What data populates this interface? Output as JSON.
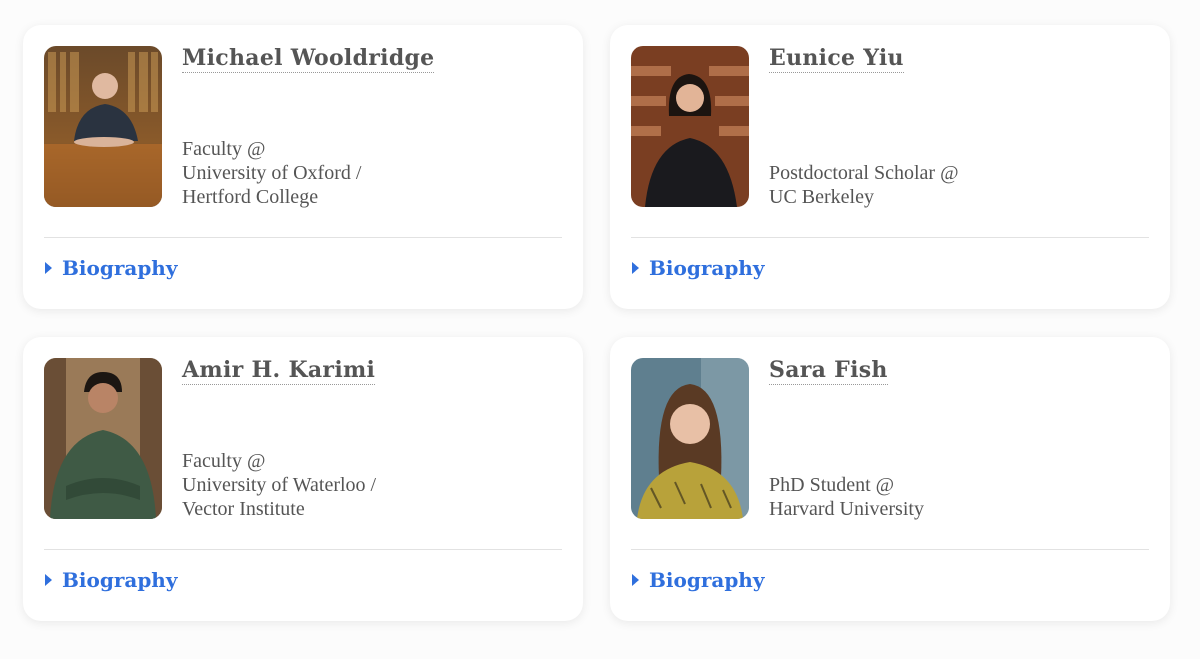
{
  "people": [
    {
      "name": "Michael Wooldridge",
      "affiliation": [
        "Faculty @",
        "University of Oxford /",
        "Hertford College"
      ],
      "photo_alt": "photo of Michael Wooldridge",
      "bio_label": "Biography"
    },
    {
      "name": "Eunice Yiu",
      "affiliation": [
        "Postdoctoral Scholar @",
        "UC Berkeley"
      ],
      "photo_alt": "photo of Eunice Yiu",
      "bio_label": "Biography"
    },
    {
      "name": "Amir H. Karimi",
      "affiliation": [
        "Faculty @",
        "University of Waterloo /",
        "Vector Institute"
      ],
      "photo_alt": "photo of Amir H. Karimi",
      "bio_label": "Biography"
    },
    {
      "name": "Sara Fish",
      "affiliation": [
        "PhD Student @",
        "Harvard University"
      ],
      "photo_alt": "photo of Sara Fish",
      "bio_label": "Biography"
    }
  ],
  "colors": {
    "link": "#2f6fdd",
    "text": "#555555",
    "card": "#ffffff",
    "page": "#fcfcfc"
  },
  "icons": {
    "expander": "caret-right-icon"
  }
}
